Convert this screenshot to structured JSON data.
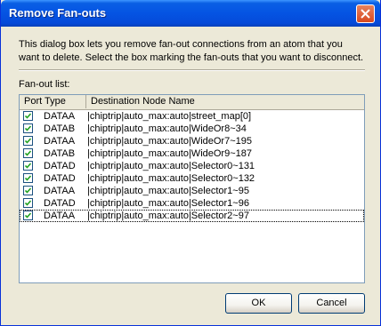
{
  "window": {
    "title": "Remove Fan-outs"
  },
  "dialog": {
    "description": "This dialog box lets you remove fan-out connections from an atom that you want to delete. Select the box marking the fan-outs that you want to disconnect.",
    "list_label": "Fan-out list:"
  },
  "table": {
    "columns": [
      "Port Type",
      "Destination Node Name"
    ],
    "rows": [
      {
        "checked": true,
        "port": "DATAA",
        "dest": "|chiptrip|auto_max:auto|street_map[0]"
      },
      {
        "checked": true,
        "port": "DATAB",
        "dest": "|chiptrip|auto_max:auto|WideOr8~34"
      },
      {
        "checked": true,
        "port": "DATAA",
        "dest": "|chiptrip|auto_max:auto|WideOr7~195"
      },
      {
        "checked": true,
        "port": "DATAB",
        "dest": "|chiptrip|auto_max:auto|WideOr9~187"
      },
      {
        "checked": true,
        "port": "DATAD",
        "dest": "|chiptrip|auto_max:auto|Selector0~131"
      },
      {
        "checked": true,
        "port": "DATAD",
        "dest": "|chiptrip|auto_max:auto|Selector0~132"
      },
      {
        "checked": true,
        "port": "DATAA",
        "dest": "|chiptrip|auto_max:auto|Selector1~95"
      },
      {
        "checked": true,
        "port": "DATAD",
        "dest": "|chiptrip|auto_max:auto|Selector1~96"
      },
      {
        "checked": true,
        "port": "DATAA",
        "dest": "|chiptrip|auto_max:auto|Selector2~97"
      }
    ]
  },
  "buttons": {
    "ok": "OK",
    "cancel": "Cancel"
  },
  "icons": {
    "close": "close-icon",
    "check": "checkmark-icon"
  },
  "colors": {
    "titlebar": "#0554e3",
    "dialog_bg": "#ece9d8",
    "close_button": "#d8491f"
  }
}
